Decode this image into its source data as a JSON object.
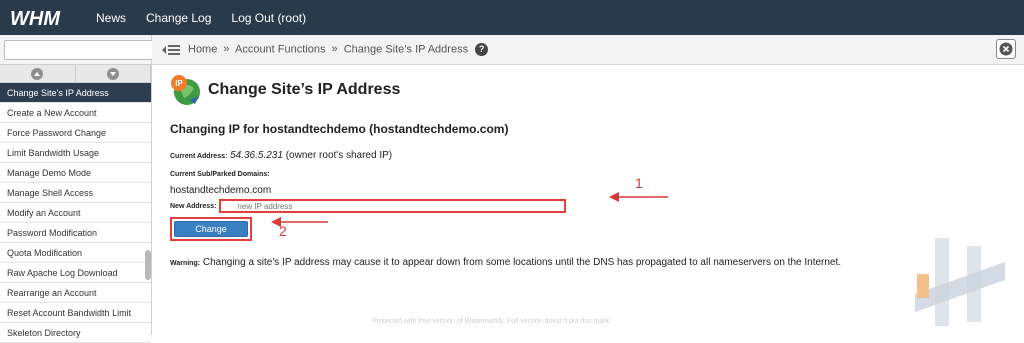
{
  "header": {
    "logo_text": "WHM",
    "nav": [
      "News",
      "Change Log",
      "Log Out (root)"
    ]
  },
  "sidebar": {
    "search_placeholder": "",
    "items": [
      {
        "label": "Change Site’s IP Address",
        "active": true
      },
      {
        "label": "Create a New Account"
      },
      {
        "label": "Force Password Change"
      },
      {
        "label": "Limit Bandwidth Usage"
      },
      {
        "label": "Manage Demo Mode"
      },
      {
        "label": "Manage Shell Access"
      },
      {
        "label": "Modify an Account"
      },
      {
        "label": "Password Modification"
      },
      {
        "label": "Quota Modification"
      },
      {
        "label": "Raw Apache Log Download"
      },
      {
        "label": "Rearrange an Account"
      },
      {
        "label": "Reset Account Bandwidth Limit"
      },
      {
        "label": "Skeleton Directory"
      }
    ]
  },
  "breadcrumb": {
    "home": "Home",
    "section": "Account Functions",
    "page": "Change Site’s IP Address",
    "sep": "»"
  },
  "page": {
    "title": "Change Site’s IP Address",
    "subheading": "Changing IP for hostandtechdemo (hostandtechdemo.com)",
    "current_address_label": "Current Address:",
    "current_address_value": "54.36.5.231",
    "current_address_note": "(owner root's shared IP)",
    "domains_label": "Current Sub/Parked Domains:",
    "domain": "hostandtechdemo.com",
    "new_address_label": "New Address:",
    "new_address_placeholder": "new IP address",
    "change_button": "Change",
    "warning_label": "Warning:",
    "warning_text": "Changing a site's IP address may cause it to appear down from some locations until the DNS has propagated to all nameservers on the Internet."
  },
  "annotations": {
    "one": "1",
    "two": "2"
  },
  "watermark": "Protected with free version of Watermarkly. Full version doesn't put this mark.",
  "colors": {
    "topbar": "#293a4a",
    "accent_red": "#e0403b",
    "button_blue": "#3a7fc1",
    "search_orange": "#f28a2e"
  }
}
